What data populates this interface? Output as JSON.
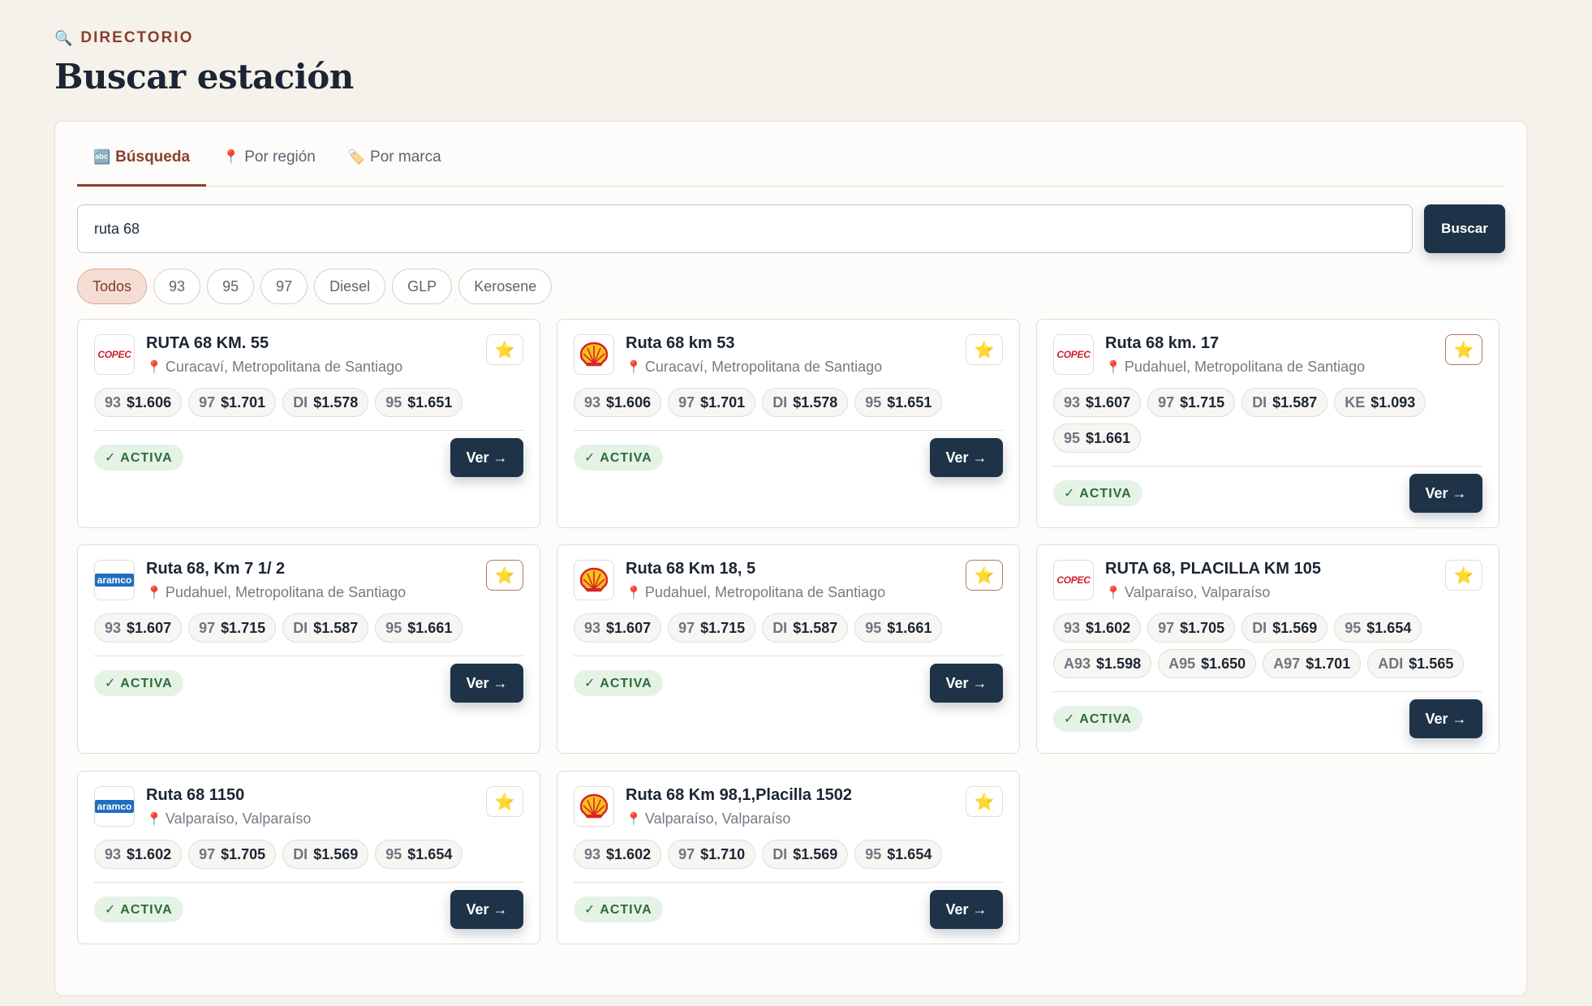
{
  "header": {
    "eyebrow_icon": "magnifier-icon",
    "eyebrow": "DIRECTORIO",
    "title": "Buscar estación"
  },
  "tabs": [
    {
      "icon": "abc-icon",
      "glyph": "🔤",
      "label": "Búsqueda",
      "active": true
    },
    {
      "icon": "pin-icon",
      "glyph": "📍",
      "label": "Por región",
      "active": false
    },
    {
      "icon": "tag-icon",
      "glyph": "🏷️",
      "label": "Por marca",
      "active": false
    }
  ],
  "search": {
    "value": "ruta 68",
    "button_label": "Buscar"
  },
  "filters": [
    "Todos",
    "93",
    "95",
    "97",
    "Diesel",
    "GLP",
    "Kerosene"
  ],
  "active_filter": "Todos",
  "stations": [
    {
      "brand": "copec",
      "name": "RUTA 68 KM. 55",
      "location": "Curacaví, Metropolitana de Santiago",
      "prices": [
        [
          "93",
          "$1.606"
        ],
        [
          "97",
          "$1.701"
        ],
        [
          "DI",
          "$1.578"
        ],
        [
          "95",
          "$1.651"
        ]
      ],
      "status": "✓ ACTIVA",
      "action": "Ver →"
    },
    {
      "brand": "shell",
      "name": "Ruta 68 km 53",
      "location": "Curacaví, Metropolitana de Santiago",
      "prices": [
        [
          "93",
          "$1.606"
        ],
        [
          "97",
          "$1.701"
        ],
        [
          "DI",
          "$1.578"
        ],
        [
          "95",
          "$1.651"
        ]
      ],
      "status": "✓ ACTIVA",
      "action": "Ver →"
    },
    {
      "brand": "copec",
      "name": "Ruta 68 km. 17",
      "location": "Pudahuel, Metropolitana de Santiago",
      "prices": [
        [
          "93",
          "$1.607"
        ],
        [
          "97",
          "$1.715"
        ],
        [
          "DI",
          "$1.587"
        ],
        [
          "KE",
          "$1.093"
        ],
        [
          "95",
          "$1.661"
        ]
      ],
      "status": "✓ ACTIVA",
      "action": "Ver →"
    },
    {
      "brand": "aramco",
      "name": "Ruta 68, Km 7 1/ 2",
      "location": "Pudahuel, Metropolitana de Santiago",
      "prices": [
        [
          "93",
          "$1.607"
        ],
        [
          "97",
          "$1.715"
        ],
        [
          "DI",
          "$1.587"
        ],
        [
          "95",
          "$1.661"
        ]
      ],
      "status": "✓ ACTIVA",
      "action": "Ver →"
    },
    {
      "brand": "shell",
      "name": "Ruta 68 Km 18, 5",
      "location": "Pudahuel, Metropolitana de Santiago",
      "prices": [
        [
          "93",
          "$1.607"
        ],
        [
          "97",
          "$1.715"
        ],
        [
          "DI",
          "$1.587"
        ],
        [
          "95",
          "$1.661"
        ]
      ],
      "status": "✓ ACTIVA",
      "action": "Ver →"
    },
    {
      "brand": "copec",
      "name": "RUTA 68, PLACILLA KM 105",
      "location": "Valparaíso, Valparaíso",
      "prices": [
        [
          "93",
          "$1.602"
        ],
        [
          "97",
          "$1.705"
        ],
        [
          "DI",
          "$1.569"
        ],
        [
          "95",
          "$1.654"
        ],
        [
          "A93",
          "$1.598"
        ],
        [
          "A95",
          "$1.650"
        ],
        [
          "A97",
          "$1.701"
        ],
        [
          "ADI",
          "$1.565"
        ]
      ],
      "status": "✓ ACTIVA",
      "action": "Ver →"
    },
    {
      "brand": "aramco",
      "name": "Ruta 68 1150",
      "location": "Valparaíso, Valparaíso",
      "prices": [
        [
          "93",
          "$1.602"
        ],
        [
          "97",
          "$1.705"
        ],
        [
          "DI",
          "$1.569"
        ],
        [
          "95",
          "$1.654"
        ]
      ],
      "status": "✓ ACTIVA",
      "action": "Ver →"
    },
    {
      "brand": "shell",
      "name": "Ruta 68 Km 98,1,Placilla 1502",
      "location": "Valparaíso, Valparaíso",
      "prices": [
        [
          "93",
          "$1.602"
        ],
        [
          "97",
          "$1.710"
        ],
        [
          "DI",
          "$1.569"
        ],
        [
          "95",
          "$1.654"
        ]
      ],
      "status": "✓ ACTIVA",
      "action": "Ver →"
    }
  ],
  "logos": {
    "copec": "COPEC",
    "aramco": "aramco"
  },
  "colors": {
    "accent": "#8a3f2a",
    "navy": "#1e3348",
    "active_green": "#2e6b38",
    "star": "#f2b519"
  }
}
